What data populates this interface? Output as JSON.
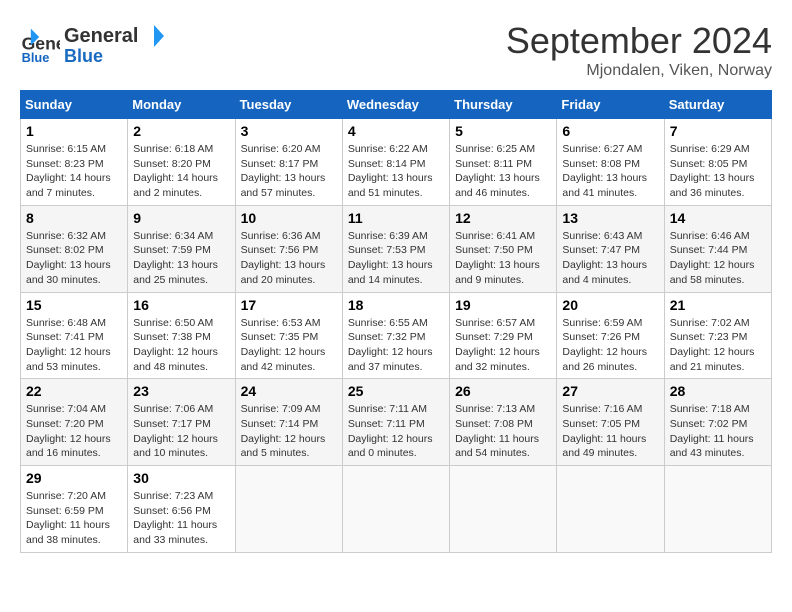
{
  "header": {
    "logo_line1": "General",
    "logo_line2": "Blue",
    "month": "September 2024",
    "location": "Mjondalen, Viken, Norway"
  },
  "columns": [
    "Sunday",
    "Monday",
    "Tuesday",
    "Wednesday",
    "Thursday",
    "Friday",
    "Saturday"
  ],
  "weeks": [
    [
      {
        "day": "1",
        "sunrise": "6:15 AM",
        "sunset": "8:23 PM",
        "daylight": "14 hours and 7 minutes."
      },
      {
        "day": "2",
        "sunrise": "6:18 AM",
        "sunset": "8:20 PM",
        "daylight": "14 hours and 2 minutes."
      },
      {
        "day": "3",
        "sunrise": "6:20 AM",
        "sunset": "8:17 PM",
        "daylight": "13 hours and 57 minutes."
      },
      {
        "day": "4",
        "sunrise": "6:22 AM",
        "sunset": "8:14 PM",
        "daylight": "13 hours and 51 minutes."
      },
      {
        "day": "5",
        "sunrise": "6:25 AM",
        "sunset": "8:11 PM",
        "daylight": "13 hours and 46 minutes."
      },
      {
        "day": "6",
        "sunrise": "6:27 AM",
        "sunset": "8:08 PM",
        "daylight": "13 hours and 41 minutes."
      },
      {
        "day": "7",
        "sunrise": "6:29 AM",
        "sunset": "8:05 PM",
        "daylight": "13 hours and 36 minutes."
      }
    ],
    [
      {
        "day": "8",
        "sunrise": "6:32 AM",
        "sunset": "8:02 PM",
        "daylight": "13 hours and 30 minutes."
      },
      {
        "day": "9",
        "sunrise": "6:34 AM",
        "sunset": "7:59 PM",
        "daylight": "13 hours and 25 minutes."
      },
      {
        "day": "10",
        "sunrise": "6:36 AM",
        "sunset": "7:56 PM",
        "daylight": "13 hours and 20 minutes."
      },
      {
        "day": "11",
        "sunrise": "6:39 AM",
        "sunset": "7:53 PM",
        "daylight": "13 hours and 14 minutes."
      },
      {
        "day": "12",
        "sunrise": "6:41 AM",
        "sunset": "7:50 PM",
        "daylight": "13 hours and 9 minutes."
      },
      {
        "day": "13",
        "sunrise": "6:43 AM",
        "sunset": "7:47 PM",
        "daylight": "13 hours and 4 minutes."
      },
      {
        "day": "14",
        "sunrise": "6:46 AM",
        "sunset": "7:44 PM",
        "daylight": "12 hours and 58 minutes."
      }
    ],
    [
      {
        "day": "15",
        "sunrise": "6:48 AM",
        "sunset": "7:41 PM",
        "daylight": "12 hours and 53 minutes."
      },
      {
        "day": "16",
        "sunrise": "6:50 AM",
        "sunset": "7:38 PM",
        "daylight": "12 hours and 48 minutes."
      },
      {
        "day": "17",
        "sunrise": "6:53 AM",
        "sunset": "7:35 PM",
        "daylight": "12 hours and 42 minutes."
      },
      {
        "day": "18",
        "sunrise": "6:55 AM",
        "sunset": "7:32 PM",
        "daylight": "12 hours and 37 minutes."
      },
      {
        "day": "19",
        "sunrise": "6:57 AM",
        "sunset": "7:29 PM",
        "daylight": "12 hours and 32 minutes."
      },
      {
        "day": "20",
        "sunrise": "6:59 AM",
        "sunset": "7:26 PM",
        "daylight": "12 hours and 26 minutes."
      },
      {
        "day": "21",
        "sunrise": "7:02 AM",
        "sunset": "7:23 PM",
        "daylight": "12 hours and 21 minutes."
      }
    ],
    [
      {
        "day": "22",
        "sunrise": "7:04 AM",
        "sunset": "7:20 PM",
        "daylight": "12 hours and 16 minutes."
      },
      {
        "day": "23",
        "sunrise": "7:06 AM",
        "sunset": "7:17 PM",
        "daylight": "12 hours and 10 minutes."
      },
      {
        "day": "24",
        "sunrise": "7:09 AM",
        "sunset": "7:14 PM",
        "daylight": "12 hours and 5 minutes."
      },
      {
        "day": "25",
        "sunrise": "7:11 AM",
        "sunset": "7:11 PM",
        "daylight": "12 hours and 0 minutes."
      },
      {
        "day": "26",
        "sunrise": "7:13 AM",
        "sunset": "7:08 PM",
        "daylight": "11 hours and 54 minutes."
      },
      {
        "day": "27",
        "sunrise": "7:16 AM",
        "sunset": "7:05 PM",
        "daylight": "11 hours and 49 minutes."
      },
      {
        "day": "28",
        "sunrise": "7:18 AM",
        "sunset": "7:02 PM",
        "daylight": "11 hours and 43 minutes."
      }
    ],
    [
      {
        "day": "29",
        "sunrise": "7:20 AM",
        "sunset": "6:59 PM",
        "daylight": "11 hours and 38 minutes."
      },
      {
        "day": "30",
        "sunrise": "7:23 AM",
        "sunset": "6:56 PM",
        "daylight": "11 hours and 33 minutes."
      },
      null,
      null,
      null,
      null,
      null
    ]
  ]
}
